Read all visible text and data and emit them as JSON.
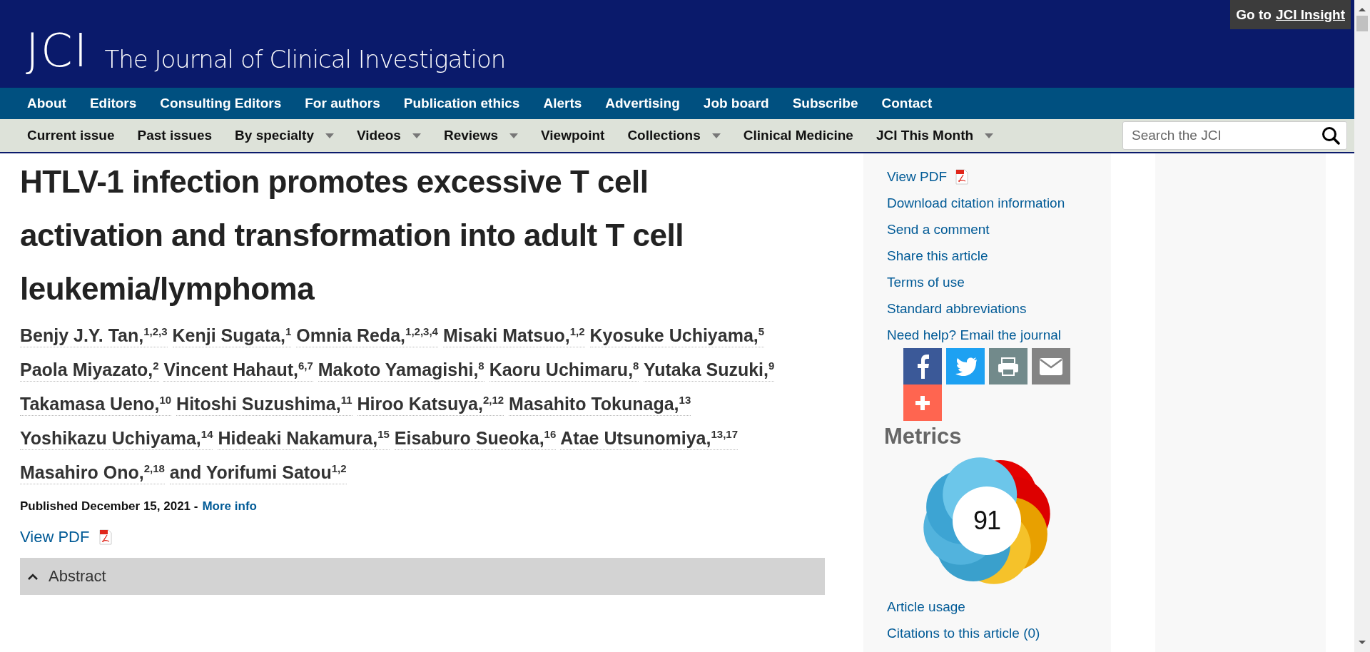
{
  "header": {
    "logo": "JCI",
    "title": "The Journal of Clinical Investigation",
    "insight_link": {
      "prefix": "Go to",
      "link": "JCI Insight"
    }
  },
  "primary_nav": [
    "About",
    "Editors",
    "Consulting Editors",
    "For authors",
    "Publication ethics",
    "Alerts",
    "Advertising",
    "Job board",
    "Subscribe",
    "Contact"
  ],
  "secondary_nav": [
    {
      "label": "Current issue",
      "dropdown": false
    },
    {
      "label": "Past issues",
      "dropdown": false
    },
    {
      "label": "By specialty",
      "dropdown": true
    },
    {
      "label": "Videos",
      "dropdown": true
    },
    {
      "label": "Reviews",
      "dropdown": true
    },
    {
      "label": "Viewpoint",
      "dropdown": false
    },
    {
      "label": "Collections",
      "dropdown": true
    },
    {
      "label": "Clinical Medicine",
      "dropdown": false
    },
    {
      "label": "JCI This Month",
      "dropdown": true
    }
  ],
  "search": {
    "placeholder": "Search the JCI"
  },
  "article": {
    "title": "HTLV-1 infection promotes excessive T cell activation and transformation into adult T cell leukemia/lymphoma",
    "authors": [
      {
        "name": "Benjy J.Y. Tan,",
        "sup": "1,2,3"
      },
      {
        "name": "Kenji Sugata,",
        "sup": "1"
      },
      {
        "name": "Omnia Reda,",
        "sup": "1,2,3,4"
      },
      {
        "name": "Misaki Matsuo,",
        "sup": "1,2"
      },
      {
        "name": "Kyosuke Uchiyama,",
        "sup": "5"
      },
      {
        "name": "Paola Miyazato,",
        "sup": "2"
      },
      {
        "name": "Vincent Hahaut,",
        "sup": "6,7"
      },
      {
        "name": "Makoto Yamagishi,",
        "sup": "8"
      },
      {
        "name": "Kaoru Uchimaru,",
        "sup": "8"
      },
      {
        "name": "Yutaka Suzuki,",
        "sup": "9"
      },
      {
        "name": "Takamasa Ueno,",
        "sup": "10"
      },
      {
        "name": "Hitoshi Suzushima,",
        "sup": "11"
      },
      {
        "name": "Hiroo Katsuya,",
        "sup": "2,12"
      },
      {
        "name": "Masahito Tokunaga,",
        "sup": "13"
      },
      {
        "name": "Yoshikazu Uchiyama,",
        "sup": "14"
      },
      {
        "name": "Hideaki Nakamura,",
        "sup": "15"
      },
      {
        "name": "Eisaburo Sueoka,",
        "sup": "16"
      },
      {
        "name": "Atae Utsunomiya,",
        "sup": "13,17"
      },
      {
        "name": "Masahiro Ono,",
        "sup": "2,18"
      },
      {
        "name": "and Yorifumi Satou",
        "sup": "1,2"
      }
    ],
    "published": "Published December 15, 2021 -",
    "more_info": "More info",
    "view_pdf": "View PDF",
    "abstract": {
      "label": "Abstract",
      "expanded": true
    }
  },
  "sidebar": {
    "links": [
      "View PDF",
      "Download citation information",
      "Send a comment",
      "Share this article",
      "Terms of use",
      "Standard abbreviations",
      "Need help? Email the journal"
    ],
    "share": [
      {
        "kind": "facebook"
      },
      {
        "kind": "twitter"
      },
      {
        "kind": "print"
      },
      {
        "kind": "email"
      },
      {
        "kind": "more"
      }
    ],
    "metrics_heading": "Metrics",
    "altmetric_score": "91",
    "bottom_links": [
      "Article usage",
      "Citations to this article (0)"
    ]
  }
}
